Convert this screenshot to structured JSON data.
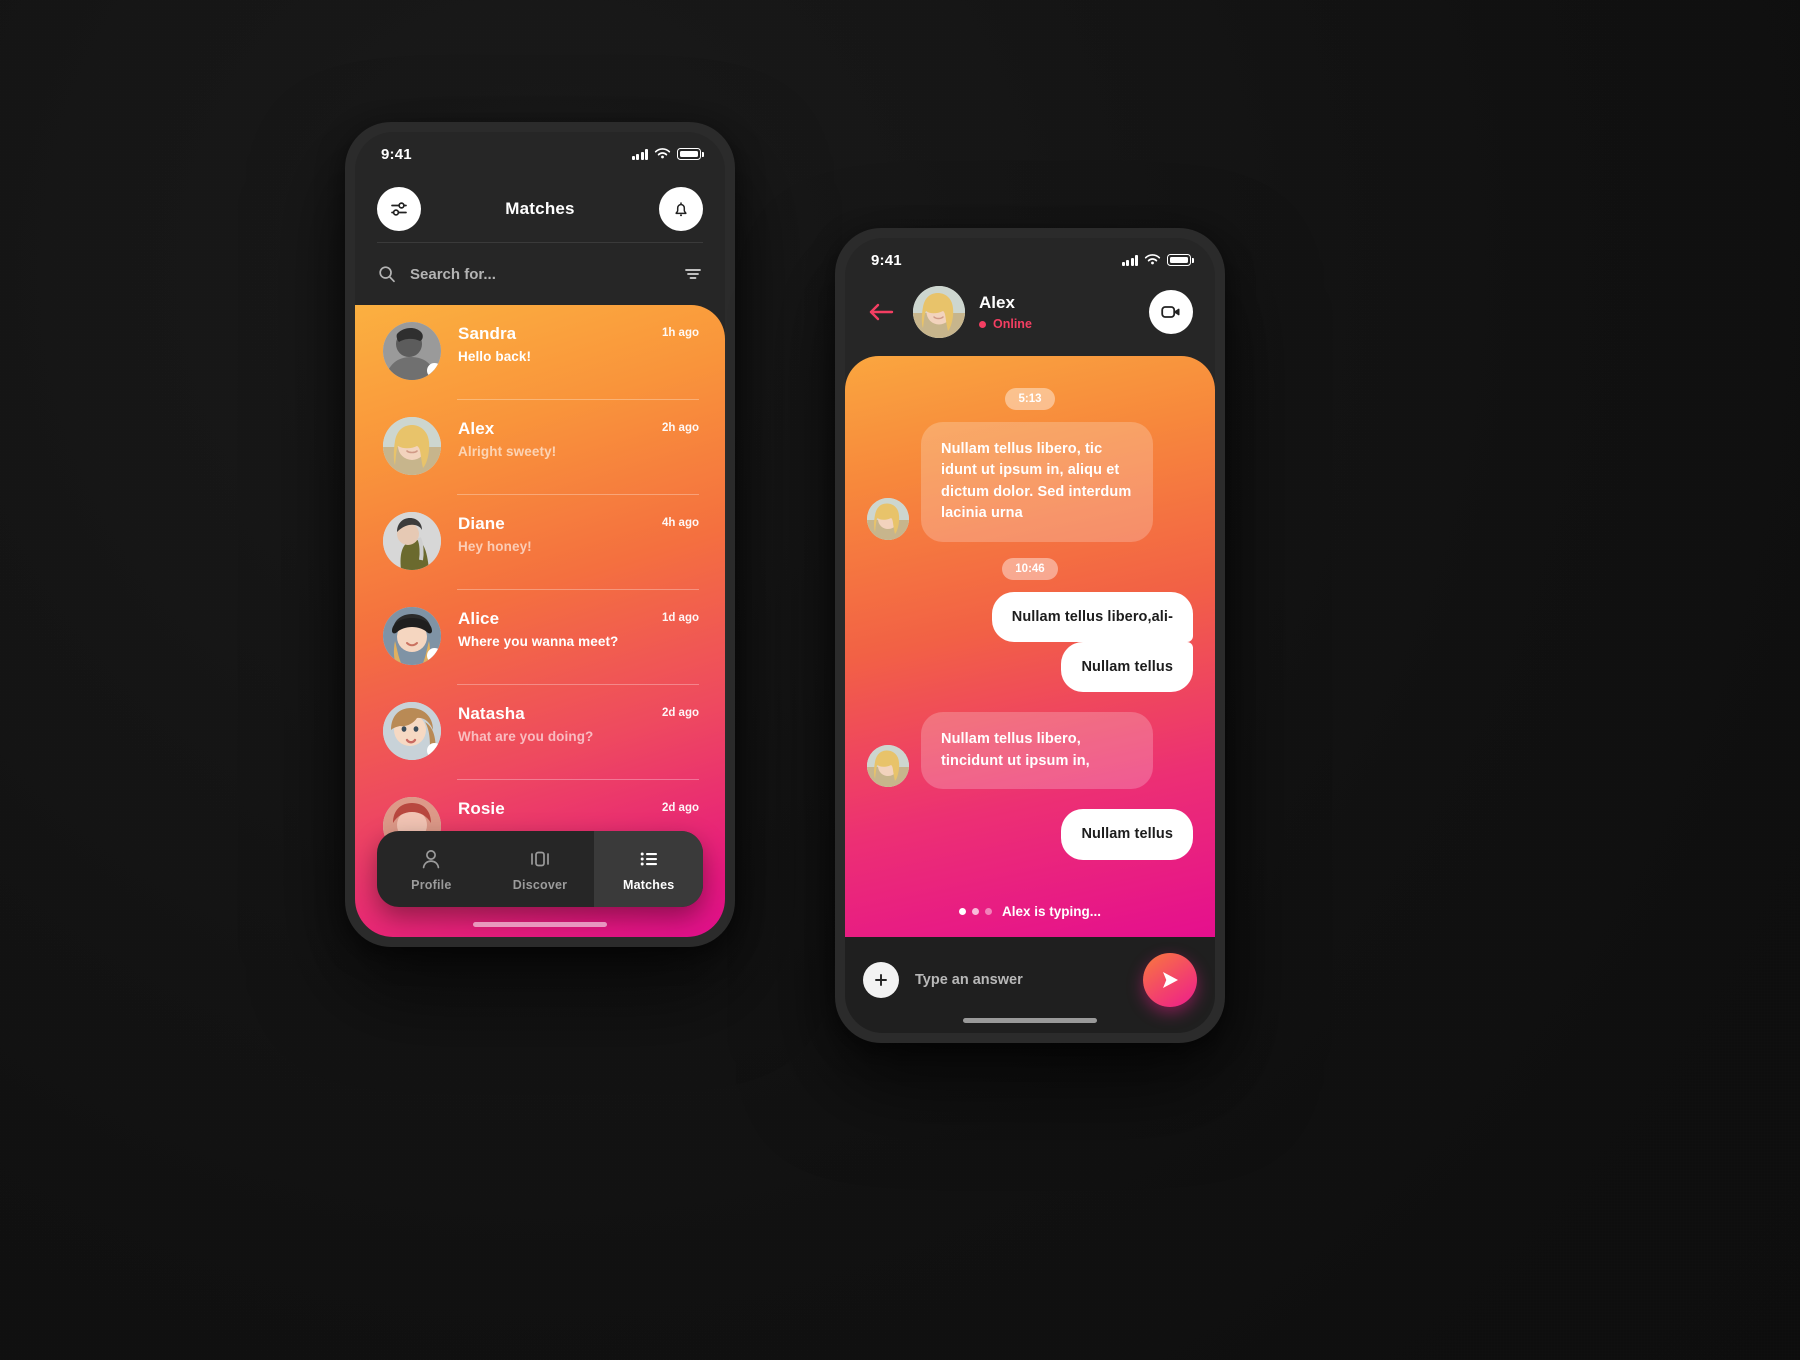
{
  "theme": {
    "accent_pink": "#F43E62",
    "gradient_start": "#FBB040",
    "gradient_end": "#E00F8C",
    "shell": "#2b2b2b",
    "panel": "#262626"
  },
  "matches_screen": {
    "status_bar": {
      "time": "9:41",
      "signal_icon": "signal-bars-icon",
      "wifi_icon": "wifi-icon",
      "battery_icon": "battery-icon"
    },
    "header": {
      "title": "Matches",
      "filter_icon": "sliders-icon",
      "notification_icon": "bell-icon"
    },
    "search": {
      "placeholder": "Search for...",
      "value": "",
      "search_icon": "search-icon",
      "sort_icon": "filter-lines-icon"
    },
    "list": [
      {
        "name": "Sandra",
        "preview": "Hello back!",
        "time": "1h ago",
        "unread": true,
        "avatar": "avatar-sandra"
      },
      {
        "name": "Alex",
        "preview": "Alright sweety!",
        "time": "2h ago",
        "unread": false,
        "avatar": "avatar-alex"
      },
      {
        "name": "Diane",
        "preview": "Hey honey!",
        "time": "4h ago",
        "unread": false,
        "avatar": "avatar-diane"
      },
      {
        "name": "Alice",
        "preview": "Where you wanna meet?",
        "time": "1d ago",
        "unread": true,
        "avatar": "avatar-alice"
      },
      {
        "name": "Natasha",
        "preview": "What are you doing?",
        "time": "2d ago",
        "unread": false,
        "avatar": "avatar-natasha"
      },
      {
        "name": "Rosie",
        "preview": "",
        "time": "2d ago",
        "unread": false,
        "avatar": "avatar-rosie"
      }
    ],
    "tabs": [
      {
        "label": "Profile",
        "icon": "person-icon",
        "active": false
      },
      {
        "label": "Discover",
        "icon": "cards-icon",
        "active": false
      },
      {
        "label": "Matches",
        "icon": "list-icon",
        "active": true
      }
    ]
  },
  "chat_screen": {
    "status_bar": {
      "time": "9:41",
      "signal_icon": "signal-bars-icon",
      "wifi_icon": "wifi-icon",
      "battery_icon": "battery-icon"
    },
    "header": {
      "back_icon": "arrow-left-icon",
      "avatar": "avatar-alex",
      "name": "Alex",
      "status": "Online",
      "video_icon": "video-camera-icon"
    },
    "messages": [
      {
        "kind": "time",
        "text": "5:13"
      },
      {
        "kind": "incoming",
        "text": "Nullam tellus libero, tic idunt ut ipsum in, aliqu et dictum dolor. Sed interdum lacinia urna",
        "avatar": "avatar-alex"
      },
      {
        "kind": "time",
        "text": "10:46"
      },
      {
        "kind": "outgoing",
        "text": "Nullam tellus libero,ali-"
      },
      {
        "kind": "outgoing",
        "text": "Nullam tellus"
      },
      {
        "kind": "incoming",
        "text": "Nullam tellus libero, tincidunt ut ipsum in,",
        "avatar": "avatar-alex"
      },
      {
        "kind": "outgoing",
        "text": "Nullam tellus"
      }
    ],
    "typing_indicator": "Alex is typing...",
    "input": {
      "attach_icon": "plus-icon",
      "placeholder": "Type an answer",
      "value": "",
      "send_icon": "send-icon"
    }
  }
}
